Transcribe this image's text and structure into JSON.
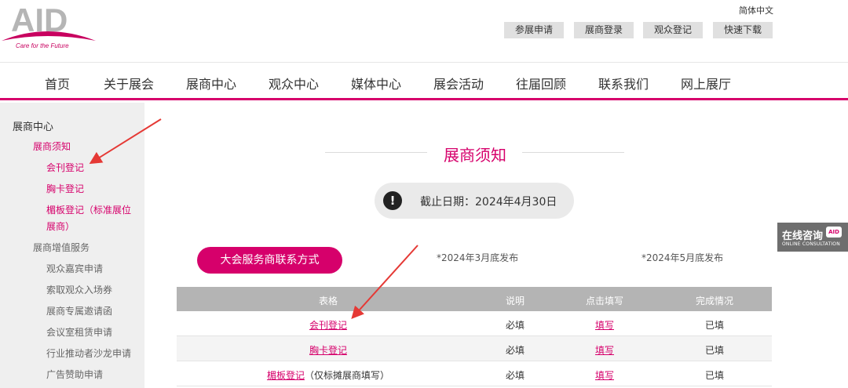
{
  "header": {
    "logo_text": "AID",
    "logo_tagline": "Care for the Future",
    "language": "简体中文",
    "quick_links": [
      "参展申请",
      "展商登录",
      "观众登记",
      "快速下载"
    ]
  },
  "nav": [
    "首页",
    "关于展会",
    "展商中心",
    "观众中心",
    "媒体中心",
    "展会活动",
    "往届回顾",
    "联系我们",
    "网上展厅"
  ],
  "sidebar": {
    "root": "展商中心",
    "group1": "展商须知",
    "group1_items": [
      "会刊登记",
      "胸卡登记",
      "楣板登记（标准展位",
      "展商）"
    ],
    "group2": "展商增值服务",
    "group2_items": [
      "观众嘉宾申请",
      "索取观众入场券",
      "展商专属邀请函",
      "会议室租赁申请",
      "行业推动者沙龙申请",
      "广告赞助申请"
    ]
  },
  "main": {
    "title": "展商须知",
    "deadline": "截止日期：2024年4月30日",
    "contact_button": "大会服务商联系方式",
    "note1": "*2024年3月底发布",
    "note2": "*2024年5月底发布"
  },
  "table": {
    "headers": [
      "表格",
      "说明",
      "点击填写",
      "完成情况"
    ],
    "rows": [
      {
        "name": "会刊登记",
        "suffix": "",
        "desc": "必填",
        "action": "填写",
        "status": "已填"
      },
      {
        "name": "胸卡登记",
        "suffix": "",
        "desc": "必填",
        "action": "填写",
        "status": "已填"
      },
      {
        "name": "楣板登记",
        "suffix": "（仅标摊展商填写）",
        "desc": "必填",
        "action": "填写",
        "status": "已填"
      }
    ]
  },
  "consult": {
    "label_cn": "在线咨询",
    "label_en": "ONLINE CONSULTATION",
    "logo": "AID"
  },
  "colors": {
    "accent": "#d6006b",
    "annotation": "#e53935"
  }
}
